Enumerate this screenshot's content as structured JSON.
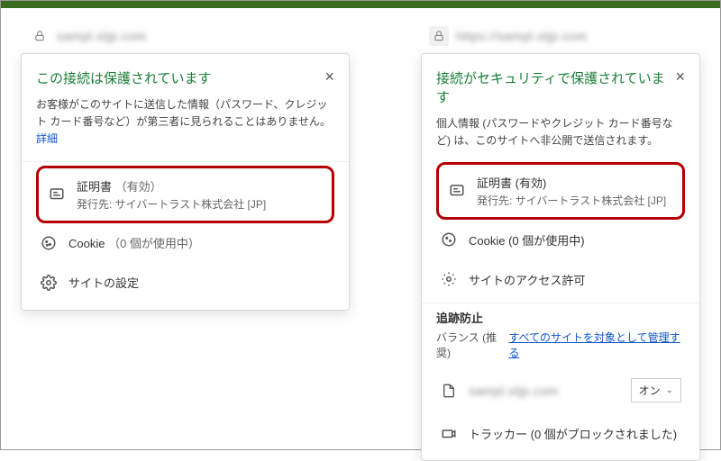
{
  "left": {
    "address": "sampl.sljp.com",
    "title": "この接続は保護されています",
    "desc": "お客様がこのサイトに送信した情報（パスワード、クレジット カード番号など）が第三者に見られることはありません。",
    "detail_link": "詳細",
    "cert_label": "証明書",
    "cert_status": "（有効）",
    "cert_issuer": "発行先: サイバートラスト株式会社 [JP]",
    "cookie": "Cookie",
    "cookie_status": "（0 個が使用中）",
    "site_settings": "サイトの設定"
  },
  "right": {
    "address": "https://sampl.sljp.com",
    "title": "接続がセキュリティで保護されています",
    "desc": "個人情報 (パスワードやクレジット カード番号など) は、このサイトへ非公開で送信されます。",
    "cert_label": "証明書 (有効)",
    "cert_issuer": "発行先: サイバートラスト株式会社 [JP]",
    "cookie": "Cookie (0 個が使用中)",
    "perms": "サイトのアクセス許可",
    "tracking_title": "追跡防止",
    "balance": "バランス (推奨)",
    "manage_link": "すべてのサイトを対象として管理する",
    "domain": "sampl.sljp.com",
    "toggle": "オン",
    "tracker": "トラッカー (0 個がブロックされました)"
  }
}
